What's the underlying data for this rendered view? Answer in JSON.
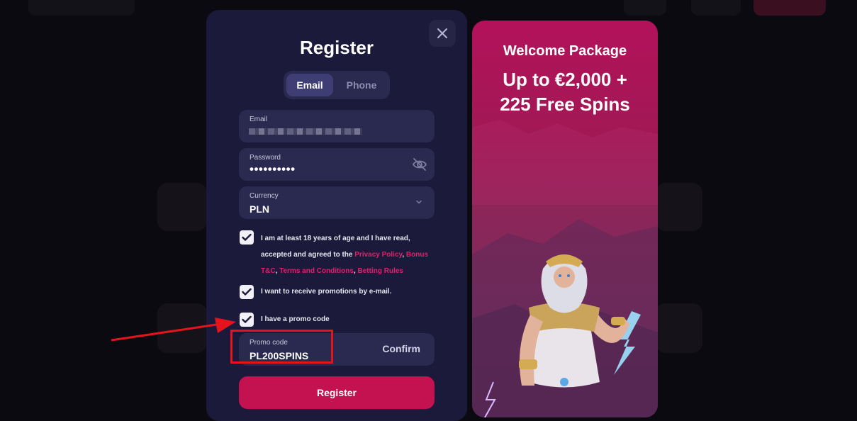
{
  "modal": {
    "title": "Register",
    "tabs": [
      {
        "label": "Email",
        "active": true
      },
      {
        "label": "Phone",
        "active": false
      }
    ],
    "email": {
      "label": "Email"
    },
    "password": {
      "label": "Password",
      "value": "••••••••••"
    },
    "currency": {
      "label": "Currency",
      "value": "PLN"
    },
    "checkboxes": {
      "age": {
        "checked": true,
        "text_a": "I am at least 18 years of age and I have read, accepted and agreed to the ",
        "link_privacy": "Privacy Policy",
        "sep1": ", ",
        "link_bonus": "Bonus T&C",
        "sep2": ", ",
        "link_terms": "Terms and Conditions",
        "sep3": ", ",
        "link_betting": "Betting Rules"
      },
      "promotions": {
        "checked": true,
        "text": "I want to receive promotions by e-mail."
      },
      "promo_code": {
        "checked": true,
        "text": "I have a promo code"
      }
    },
    "promo_field": {
      "label": "Promo code",
      "value": "PL200SPINS",
      "confirm_label": "Confirm"
    },
    "register_label": "Register"
  },
  "promo_panel": {
    "title": "Welcome Package",
    "line1": "Up to €2,000 +",
    "line2": "225 Free Spins"
  },
  "colors": {
    "accent": "#c4114f",
    "link": "#e0206a",
    "modal_bg": "#1b1a3b",
    "field_bg": "#2a2950",
    "annotation": "#e3141c"
  },
  "icons": [
    "close-icon",
    "eye-off-icon",
    "chevron-down-icon",
    "check-icon",
    "zeus-illustration",
    "annotation-arrow"
  ]
}
